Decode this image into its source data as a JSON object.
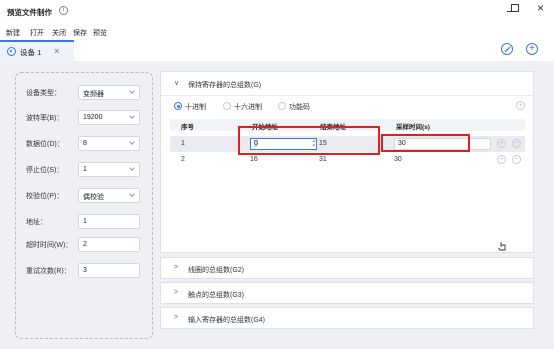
{
  "app": {
    "title": "预览文件制作",
    "info_icon": "info-icon"
  },
  "menu": [
    "新建",
    "打开",
    "关闭",
    "保存",
    "预览"
  ],
  "tab": {
    "label": "设备 1",
    "close": "×"
  },
  "tab_actions": [
    "edit-icon",
    "add-icon"
  ],
  "form": {
    "fields": [
      {
        "label": "设备类型：",
        "value": "变频器",
        "type": "select"
      },
      {
        "label": "波特率(B)：",
        "value": "19200",
        "type": "select"
      },
      {
        "label": "数据位(D)：",
        "value": "8",
        "type": "select"
      },
      {
        "label": "停止位(S)：",
        "value": "1",
        "type": "select"
      },
      {
        "label": "校验位(P)：",
        "value": "偶校验",
        "type": "select"
      },
      {
        "label": "地址：",
        "value": "1",
        "type": "input"
      },
      {
        "label": "超时时间(W)：",
        "value": "2",
        "type": "input"
      },
      {
        "label": "重试次数(R)：",
        "value": "3",
        "type": "input"
      }
    ]
  },
  "group1": {
    "title": "保持寄存器的总组数(G)",
    "radios": [
      {
        "label": "十进制",
        "selected": true
      },
      {
        "label": "十六进制",
        "selected": false
      },
      {
        "label": "功能码",
        "selected": false
      }
    ],
    "columns": [
      "序号",
      "开始地址",
      "结束地址",
      "采样时间(s)"
    ],
    "rows": [
      {
        "index": "1",
        "start": "0",
        "end": "15",
        "sample": "30",
        "editing": true
      },
      {
        "index": "2",
        "start": "16",
        "end": "31",
        "sample": "30",
        "editing": false
      }
    ]
  },
  "groups": [
    {
      "title": "线圈的总组数(G2)"
    },
    {
      "title": "触点的总组数(G3)"
    },
    {
      "title": "输入寄存器的总组数(G4)"
    }
  ],
  "colors": {
    "accent": "#3a77e6",
    "highlight": "#e02020"
  }
}
